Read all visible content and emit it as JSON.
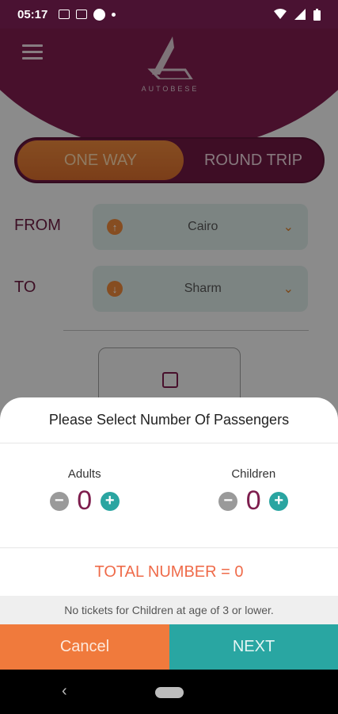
{
  "status_bar": {
    "time": "05:17",
    "icons": [
      "notification-icon",
      "facebook-icon",
      "app-icon",
      "dot-icon",
      "wifi-icon",
      "signal-icon",
      "battery-icon"
    ]
  },
  "header": {
    "brand": "AUTOBESE"
  },
  "trip_type": {
    "one_way_label": "ONE WAY",
    "round_trip_label": "ROUND TRIP",
    "selected": "ONE WAY"
  },
  "route": {
    "from_label": "FROM",
    "from_value": "Cairo",
    "to_label": "TO",
    "to_value": "Sharm"
  },
  "passengers_sheet": {
    "title": "Please Select Number Of Passengers",
    "adults_label": "Adults",
    "adults_value": "0",
    "children_label": "Children",
    "children_value": "0",
    "total_text": "TOTAL NUMBER = 0",
    "note": "No tickets for Children at age of 3 or lower.",
    "cancel_label": "Cancel",
    "next_label": "NEXT"
  },
  "colors": {
    "brand_purple": "#7d1d4d",
    "orange": "#f07a3c",
    "teal": "#29a6a2",
    "total_red": "#ef6b4a"
  }
}
